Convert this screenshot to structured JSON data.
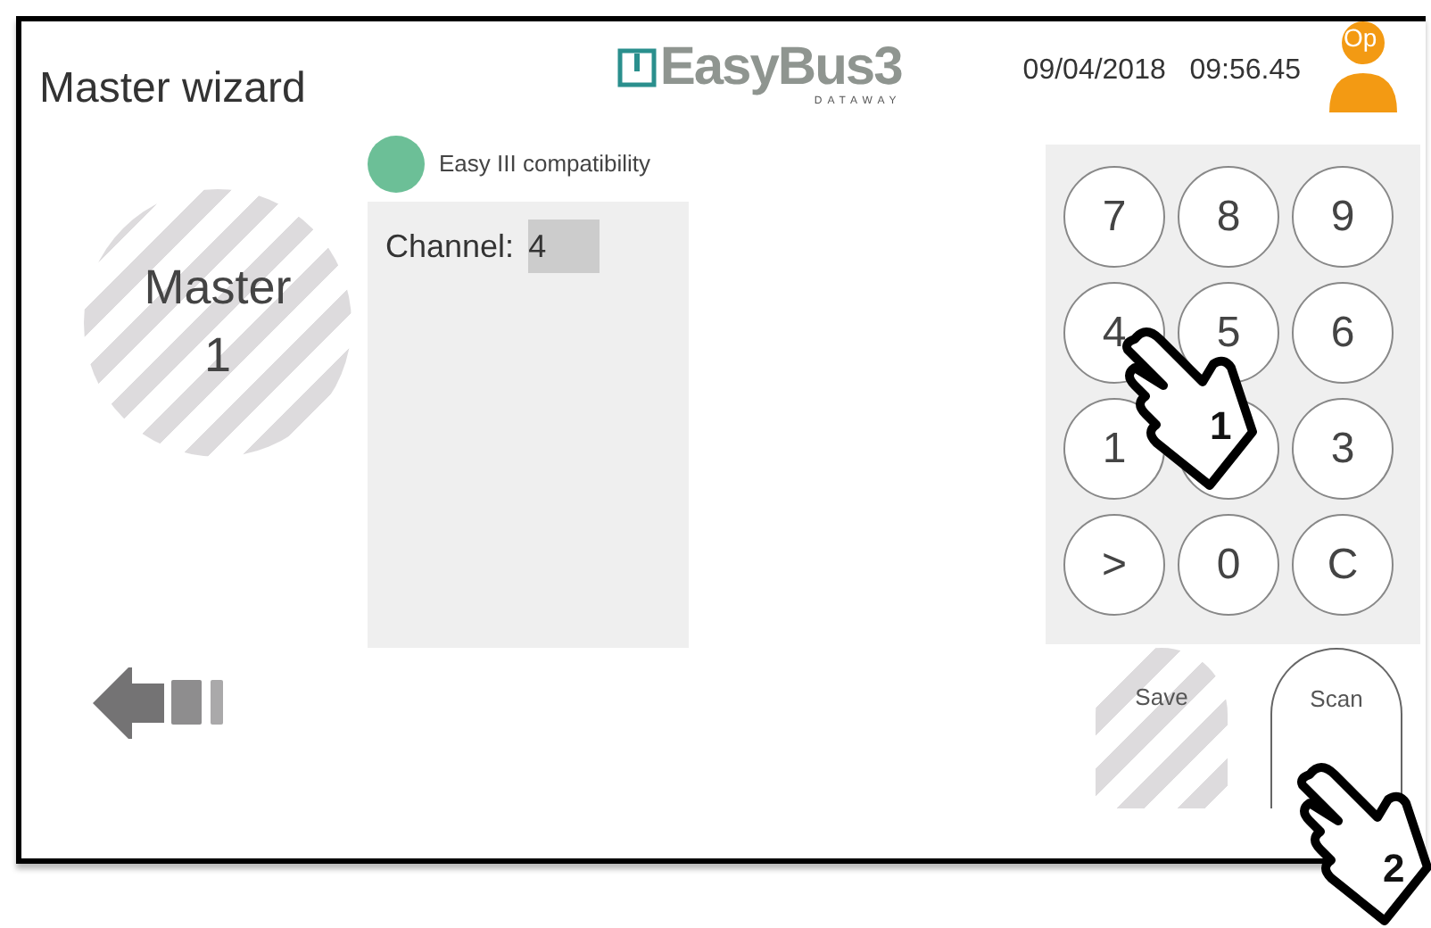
{
  "header": {
    "title": "Master wizard",
    "logo": {
      "name": "EasyBus3",
      "maker": "DATAWAY"
    },
    "date": "09/04/2018",
    "time": "09:56.45",
    "user_badge": "Op"
  },
  "master": {
    "label": "Master",
    "number": "1",
    "disabled": true
  },
  "compatibility": {
    "label": "Easy III compatibility",
    "color": "#6cbf97"
  },
  "channel": {
    "label": "Channel:",
    "value": "4"
  },
  "keypad": [
    {
      "kind": "key",
      "label": "7"
    },
    {
      "kind": "key",
      "label": "8"
    },
    {
      "kind": "key",
      "label": "9"
    },
    {
      "kind": "key",
      "label": "4"
    },
    {
      "kind": "key",
      "label": "5"
    },
    {
      "kind": "key",
      "label": "6"
    },
    {
      "kind": "key",
      "label": "1"
    },
    {
      "kind": "blank"
    },
    {
      "kind": "key",
      "label": "3"
    },
    {
      "kind": "key",
      "label": ">"
    },
    {
      "kind": "key",
      "label": "0"
    },
    {
      "kind": "key",
      "label": "C"
    }
  ],
  "buttons": [
    {
      "label": "Save",
      "disabled": true
    },
    {
      "label": "Scan",
      "disabled": false
    }
  ],
  "hints": [
    {
      "step": "1"
    },
    {
      "step": "2"
    }
  ]
}
